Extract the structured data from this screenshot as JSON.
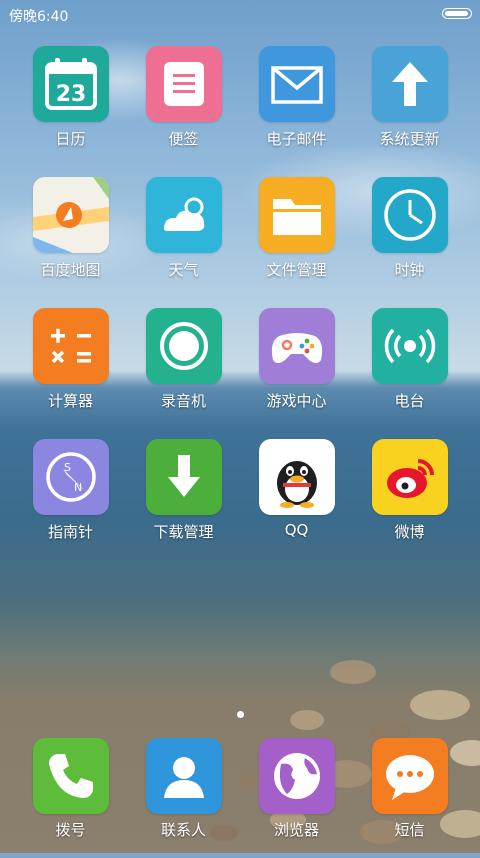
{
  "status_bar": {
    "time": "傍晚6:40",
    "battery_level": 1.0
  },
  "apps": [
    {
      "id": "calendar",
      "label": "日历",
      "icon": "calendar-icon",
      "color": "#1fa99a",
      "day": "23"
    },
    {
      "id": "notes",
      "label": "便签",
      "icon": "notes-icon",
      "color": "#ef6f93"
    },
    {
      "id": "email",
      "label": "电子邮件",
      "icon": "mail-icon",
      "color": "#3f97dd"
    },
    {
      "id": "system-update",
      "label": "系统更新",
      "icon": "arrow-up-icon",
      "color": "#49a3d6"
    },
    {
      "id": "baidu-map",
      "label": "百度地图",
      "icon": "map-icon",
      "color": "#f2f2ec"
    },
    {
      "id": "weather",
      "label": "天气",
      "icon": "weather-icon",
      "color": "#2fb5d9"
    },
    {
      "id": "file-manager",
      "label": "文件管理",
      "icon": "folder-icon",
      "color": "#f6ad22"
    },
    {
      "id": "clock",
      "label": "时钟",
      "icon": "clock-icon",
      "color": "#23a8c9"
    },
    {
      "id": "calculator",
      "label": "计算器",
      "icon": "calculator-icon",
      "color": "#f47c21"
    },
    {
      "id": "recorder",
      "label": "录音机",
      "icon": "record-icon",
      "color": "#24b18e"
    },
    {
      "id": "game-center",
      "label": "游戏中心",
      "icon": "gamepad-icon",
      "color": "#a07dd6"
    },
    {
      "id": "radio",
      "label": "电台",
      "icon": "radio-icon",
      "color": "#22b0a0"
    },
    {
      "id": "compass",
      "label": "指南针",
      "icon": "compass-icon",
      "color": "#8b86df"
    },
    {
      "id": "download-manager",
      "label": "下载管理",
      "icon": "download-icon",
      "color": "#4caf3b"
    },
    {
      "id": "qq",
      "label": "QQ",
      "icon": "qq-penguin-icon",
      "color": "#ffffff"
    },
    {
      "id": "weibo",
      "label": "微博",
      "icon": "weibo-icon",
      "color": "#f8d21e"
    }
  ],
  "dock": [
    {
      "id": "dialer",
      "label": "拨号",
      "icon": "phone-icon",
      "color": "#5dbd3b"
    },
    {
      "id": "contacts",
      "label": "联系人",
      "icon": "contact-icon",
      "color": "#2f96dc"
    },
    {
      "id": "browser",
      "label": "浏览器",
      "icon": "globe-icon",
      "color": "#a45fc9"
    },
    {
      "id": "messages",
      "label": "短信",
      "icon": "message-icon",
      "color": "#f47c21"
    }
  ],
  "page_indicator": {
    "current": 1,
    "total": 1
  }
}
